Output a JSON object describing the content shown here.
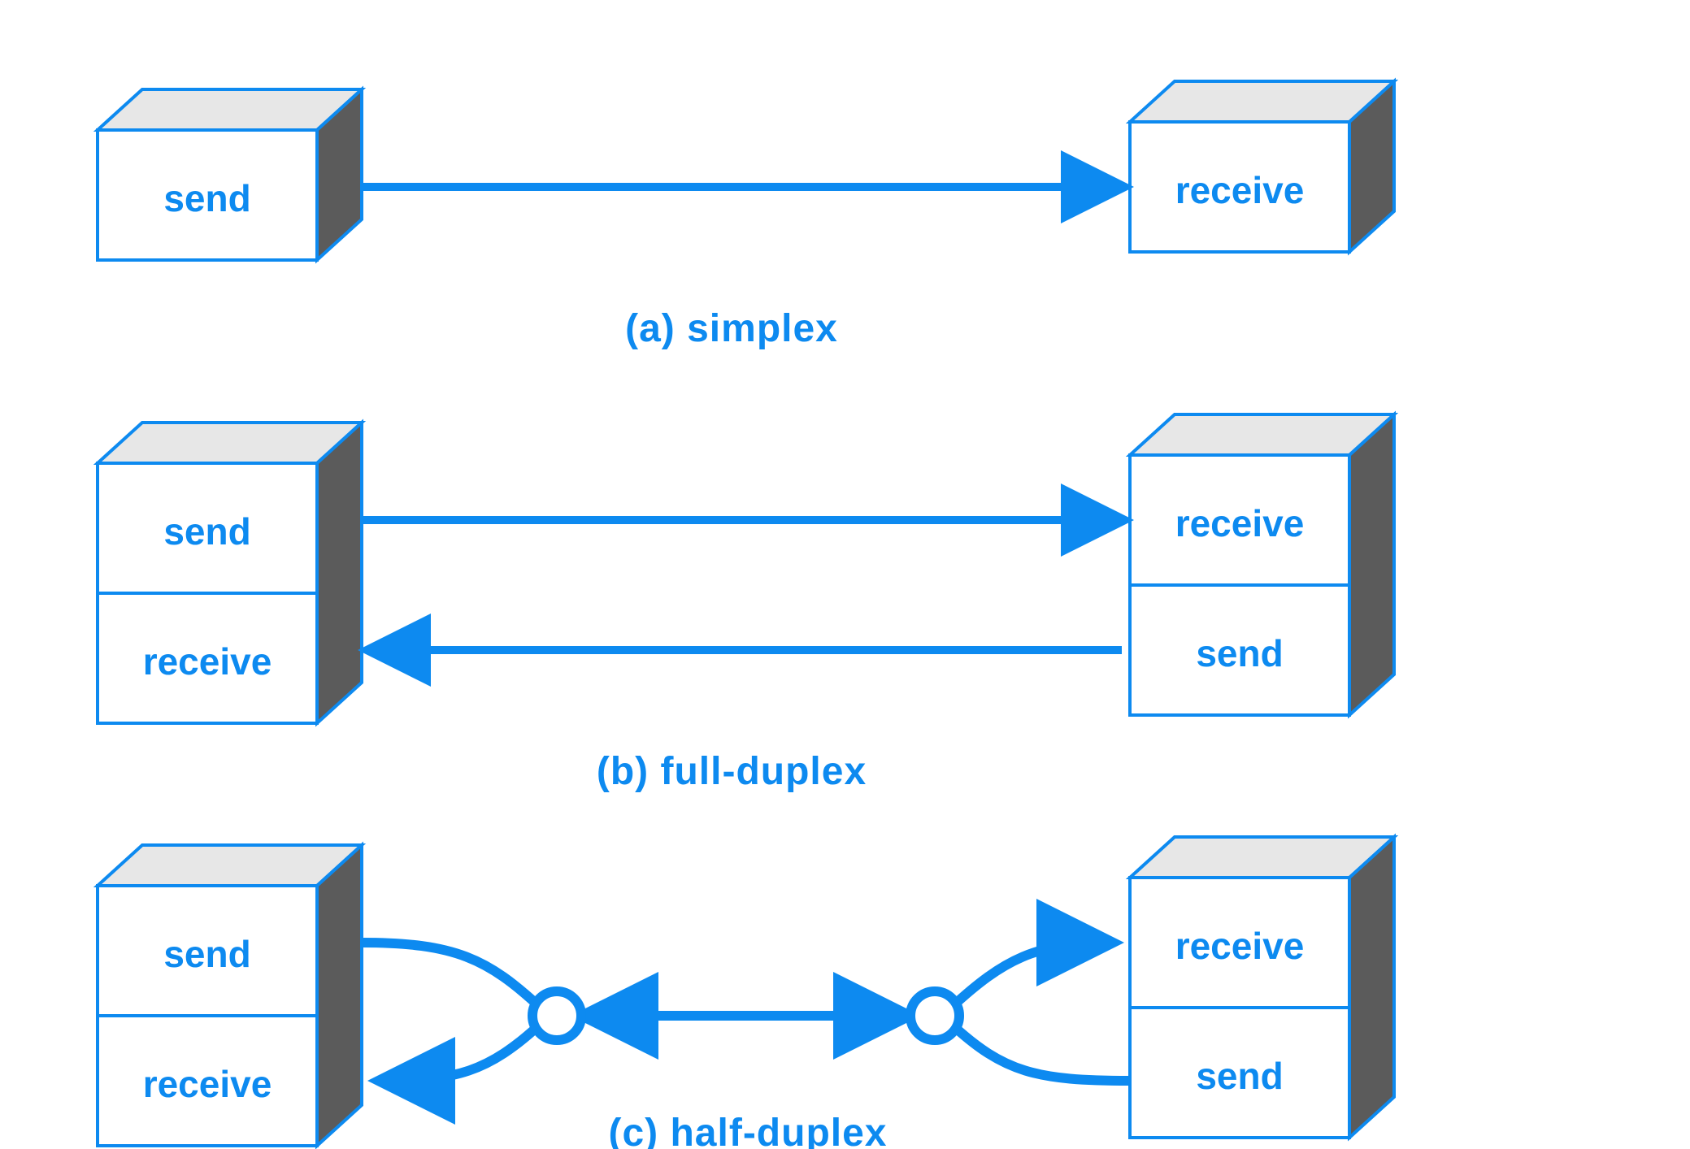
{
  "colors": {
    "blue": "#0d8af0",
    "top_shade": "#e7e7e7",
    "side_shade": "#5b5b5b",
    "white": "#ffffff"
  },
  "rows": {
    "simplex": {
      "caption": "(a)  simplex",
      "left": {
        "labels": [
          "send"
        ]
      },
      "right": {
        "labels": [
          "receive"
        ]
      }
    },
    "full_duplex": {
      "caption": "(b)  full-duplex",
      "left": {
        "labels": [
          "send",
          "receive"
        ]
      },
      "right": {
        "labels": [
          "receive",
          "send"
        ]
      }
    },
    "half_duplex": {
      "caption": "(c)  half-duplex",
      "left": {
        "labels": [
          "send",
          "receive"
        ]
      },
      "right": {
        "labels": [
          "receive",
          "send"
        ]
      }
    }
  }
}
